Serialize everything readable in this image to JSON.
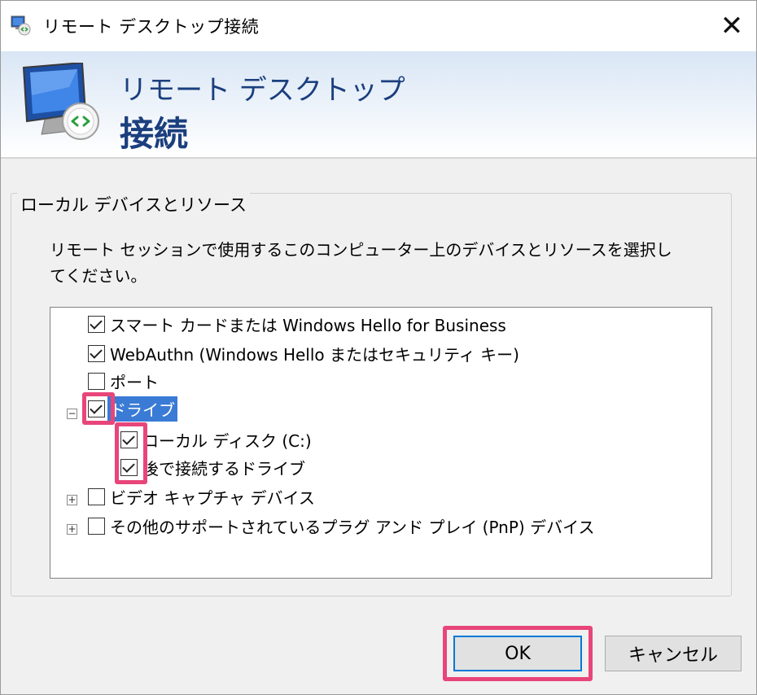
{
  "window": {
    "title": "リモート デスクトップ接続",
    "close_glyph": "✕"
  },
  "banner": {
    "line1": "リモート デスクトップ",
    "line2": "接続"
  },
  "group": {
    "legend": "ローカル デバイスとリソース",
    "description": "リモート セッションで使用するこのコンピューター上のデバイスとリソースを選択してください。"
  },
  "tree": {
    "items": [
      {
        "label": "スマート カードまたは Windows Hello for Business",
        "checked": true
      },
      {
        "label": "WebAuthn (Windows Hello またはセキュリティ キー)",
        "checked": true
      },
      {
        "label": "ポート",
        "checked": false
      },
      {
        "label": "ドライブ",
        "checked": true,
        "expander": "−",
        "selected": true
      },
      {
        "label": "ローカル ディスク (C:)",
        "checked": true
      },
      {
        "label": "後で接続するドライブ",
        "checked": true
      },
      {
        "label": "ビデオ キャプチャ デバイス",
        "checked": false,
        "expander": "+"
      },
      {
        "label": "その他のサポートされているプラグ アンド プレイ (PnP) デバイス",
        "checked": false,
        "expander": "+"
      }
    ]
  },
  "buttons": {
    "ok": "OK",
    "cancel": "キャンセル"
  },
  "colors": {
    "highlight": "#e8457a",
    "selection": "#3a7bd5",
    "banner_text": "#1b3f7e"
  }
}
